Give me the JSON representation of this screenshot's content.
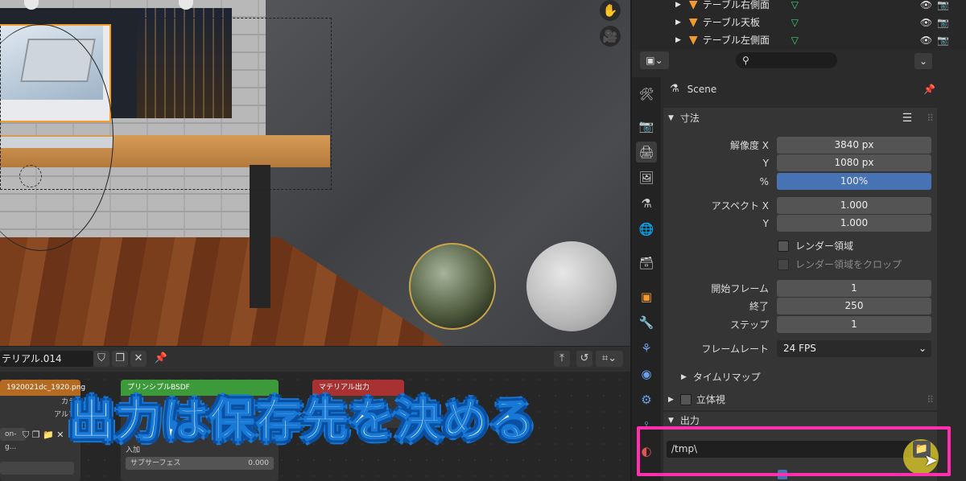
{
  "outliner": {
    "items": [
      {
        "label": "テーブル右側面"
      },
      {
        "label": "テーブル天板"
      },
      {
        "label": "テーブル左側面"
      }
    ]
  },
  "properties": {
    "search_placeholder": "",
    "scene_label": "Scene",
    "dimensions": {
      "title": "寸法",
      "resolution_x_label": "解像度 X",
      "resolution_x": "3840 px",
      "resolution_y_label": "Y",
      "resolution_y": "1080 px",
      "percent_label": "%",
      "percent": "100%",
      "percent_value": 1.0,
      "aspect_x_label": "アスペクト X",
      "aspect_x": "1.000",
      "aspect_y_label": "Y",
      "aspect_y": "1.000",
      "render_region_label": "レンダー領域",
      "crop_region_label": "レンダー領域をクロップ",
      "frame_start_label": "開始フレーム",
      "frame_start": "1",
      "frame_end_label": "終了",
      "frame_end": "250",
      "frame_step_label": "ステップ",
      "frame_step": "1",
      "framerate_label": "フレームレート",
      "framerate": "24 FPS",
      "time_remap_label": "タイムリマップ"
    },
    "stereoscopy_label": "立体視",
    "output": {
      "title": "出力",
      "path": "/tmp\\"
    }
  },
  "node_editor": {
    "material_name": "テリアル.014",
    "image_node_title": "1920021dc_1920.png",
    "image_node_color_label": "カラ",
    "image_node_alpha_label": "アルフ",
    "image_node_field": "on-g...",
    "bsdf_node_title": "プリンシプルBSDF",
    "bsdf_row1": "入加",
    "bsdf_subsurface_label": "サブサーフェス",
    "bsdf_subsurface_value": "0.000",
    "output_node_title": "マテリアル出力"
  },
  "overlay": {
    "caption": "出力は保存先を決める"
  },
  "colors": {
    "accent_blue": "#4772b3",
    "highlight_pink": "#ff2fae",
    "caption_blue": "#1778d6"
  }
}
